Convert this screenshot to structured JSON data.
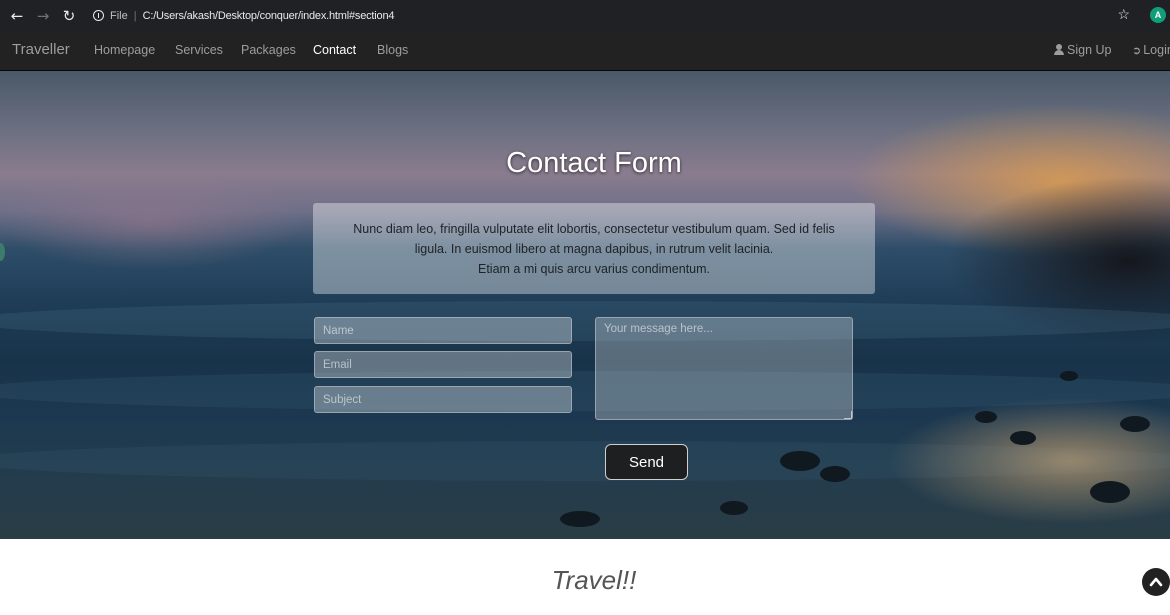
{
  "browser": {
    "back_icon": "back-arrow-icon",
    "forward_icon": "forward-arrow-icon",
    "reload_icon": "reload-icon",
    "address_prefix": "File",
    "address_separator": "|",
    "url": "C:/Users/akash/Desktop/conquer/index.html#section4",
    "bookmark_icon": "star-icon",
    "profile_initial": "A"
  },
  "navbar": {
    "brand": "Traveller",
    "links": [
      {
        "label": "Homepage"
      },
      {
        "label": "Services"
      },
      {
        "label": "Packages"
      },
      {
        "label": "Contact"
      },
      {
        "label": "Blogs"
      }
    ],
    "active_link": "Contact",
    "signup_label": "Sign Up",
    "login_label": "Login"
  },
  "contact": {
    "title": "Contact Form",
    "intro_line1": "Nunc diam leo, fringilla vulputate elit lobortis, consectetur vestibulum quam. Sed id felis ligula. In euismod libero at magna dapibus, in rutrum velit lacinia.",
    "intro_line2": "Etiam a mi quis arcu varius condimentum.",
    "name_placeholder": "Name",
    "email_placeholder": "Email",
    "subject_placeholder": "Subject",
    "message_placeholder": "Your message here...",
    "send_label": "Send"
  },
  "next_section": {
    "heading": "Travel!!"
  },
  "colors": {
    "navbar_bg": "#222222",
    "nav_text": "#9d9d9d",
    "nav_active": "#ffffff",
    "button_bg": "#1e1f21",
    "profile_bg": "#0f9d7a"
  }
}
